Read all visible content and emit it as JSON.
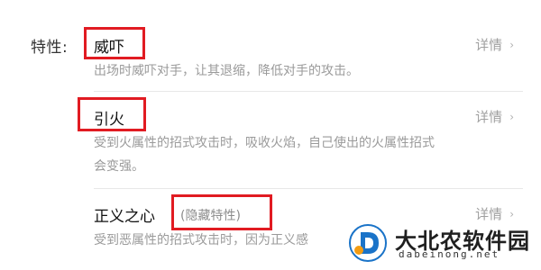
{
  "section_label": "特性:",
  "abilities": [
    {
      "name": "威吓",
      "hidden_tag": "",
      "details_label": "详情",
      "description_lines": [
        "出场时威吓对手，让其退缩，降低对手的攻击。"
      ]
    },
    {
      "name": "引火",
      "hidden_tag": "",
      "details_label": "详情",
      "description_lines": [
        "受到火属性的招式攻击时，吸收火焰，自己使出的火属性招式",
        "会变强。"
      ]
    },
    {
      "name": "正义之心",
      "hidden_tag": "(隐藏特性)",
      "details_label": "详情",
      "description_lines": [
        "受到恶属性的招式攻击时，因为正义感"
      ]
    }
  ],
  "colors": {
    "highlight_box": "#e11b22",
    "watermark_brand_blue": "#1a73c8"
  },
  "watermark": {
    "logo_icon": "d-logo-icon",
    "brand_text": "大北农软件园",
    "domain_text": "dabeinong.net"
  }
}
